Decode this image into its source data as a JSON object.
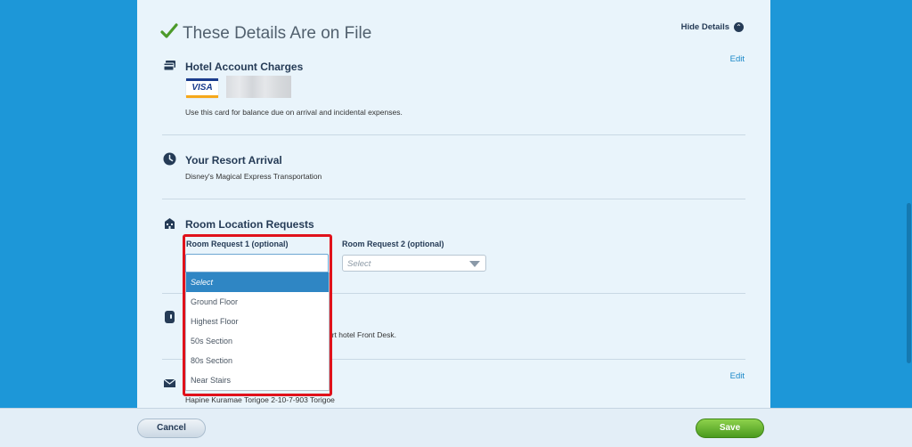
{
  "header": {
    "title": "These Details Are on File",
    "hide_details": "Hide Details",
    "hide_icon": "circle-up-icon"
  },
  "hotel_charges": {
    "title": "Hotel Account Charges",
    "card_brand": "VISA",
    "description": "Use this card for balance due on arrival and incidental expenses.",
    "edit": "Edit"
  },
  "arrival": {
    "title": "Your Resort Arrival",
    "description": "Disney's Magical Express Transportation"
  },
  "room_requests": {
    "title": "Room Location Requests",
    "request1_label": "Room Request 1 (optional)",
    "request2_label": "Room Request 2 (optional)",
    "request2_value": "Select",
    "options": [
      "Select",
      "Ground Floor",
      "Highest Floor",
      "50s Section",
      "80s Section",
      "Near Stairs"
    ],
    "selected_index": 0
  },
  "checkin": {
    "description_partial": "esort hotel Front Desk."
  },
  "mail": {
    "address_partial": "Hapine Kuramae Torigoe 2-10-7-903 Torigoe",
    "edit": "Edit"
  },
  "footer": {
    "cancel": "Cancel",
    "save": "Save"
  },
  "colors": {
    "page_bg": "#1d97d8",
    "panel_bg": "#e9f4fb",
    "check_green": "#4c9a2a",
    "link_blue": "#1a88c8",
    "highlight_red": "#e0121b",
    "save_green": "#5aab2a"
  }
}
